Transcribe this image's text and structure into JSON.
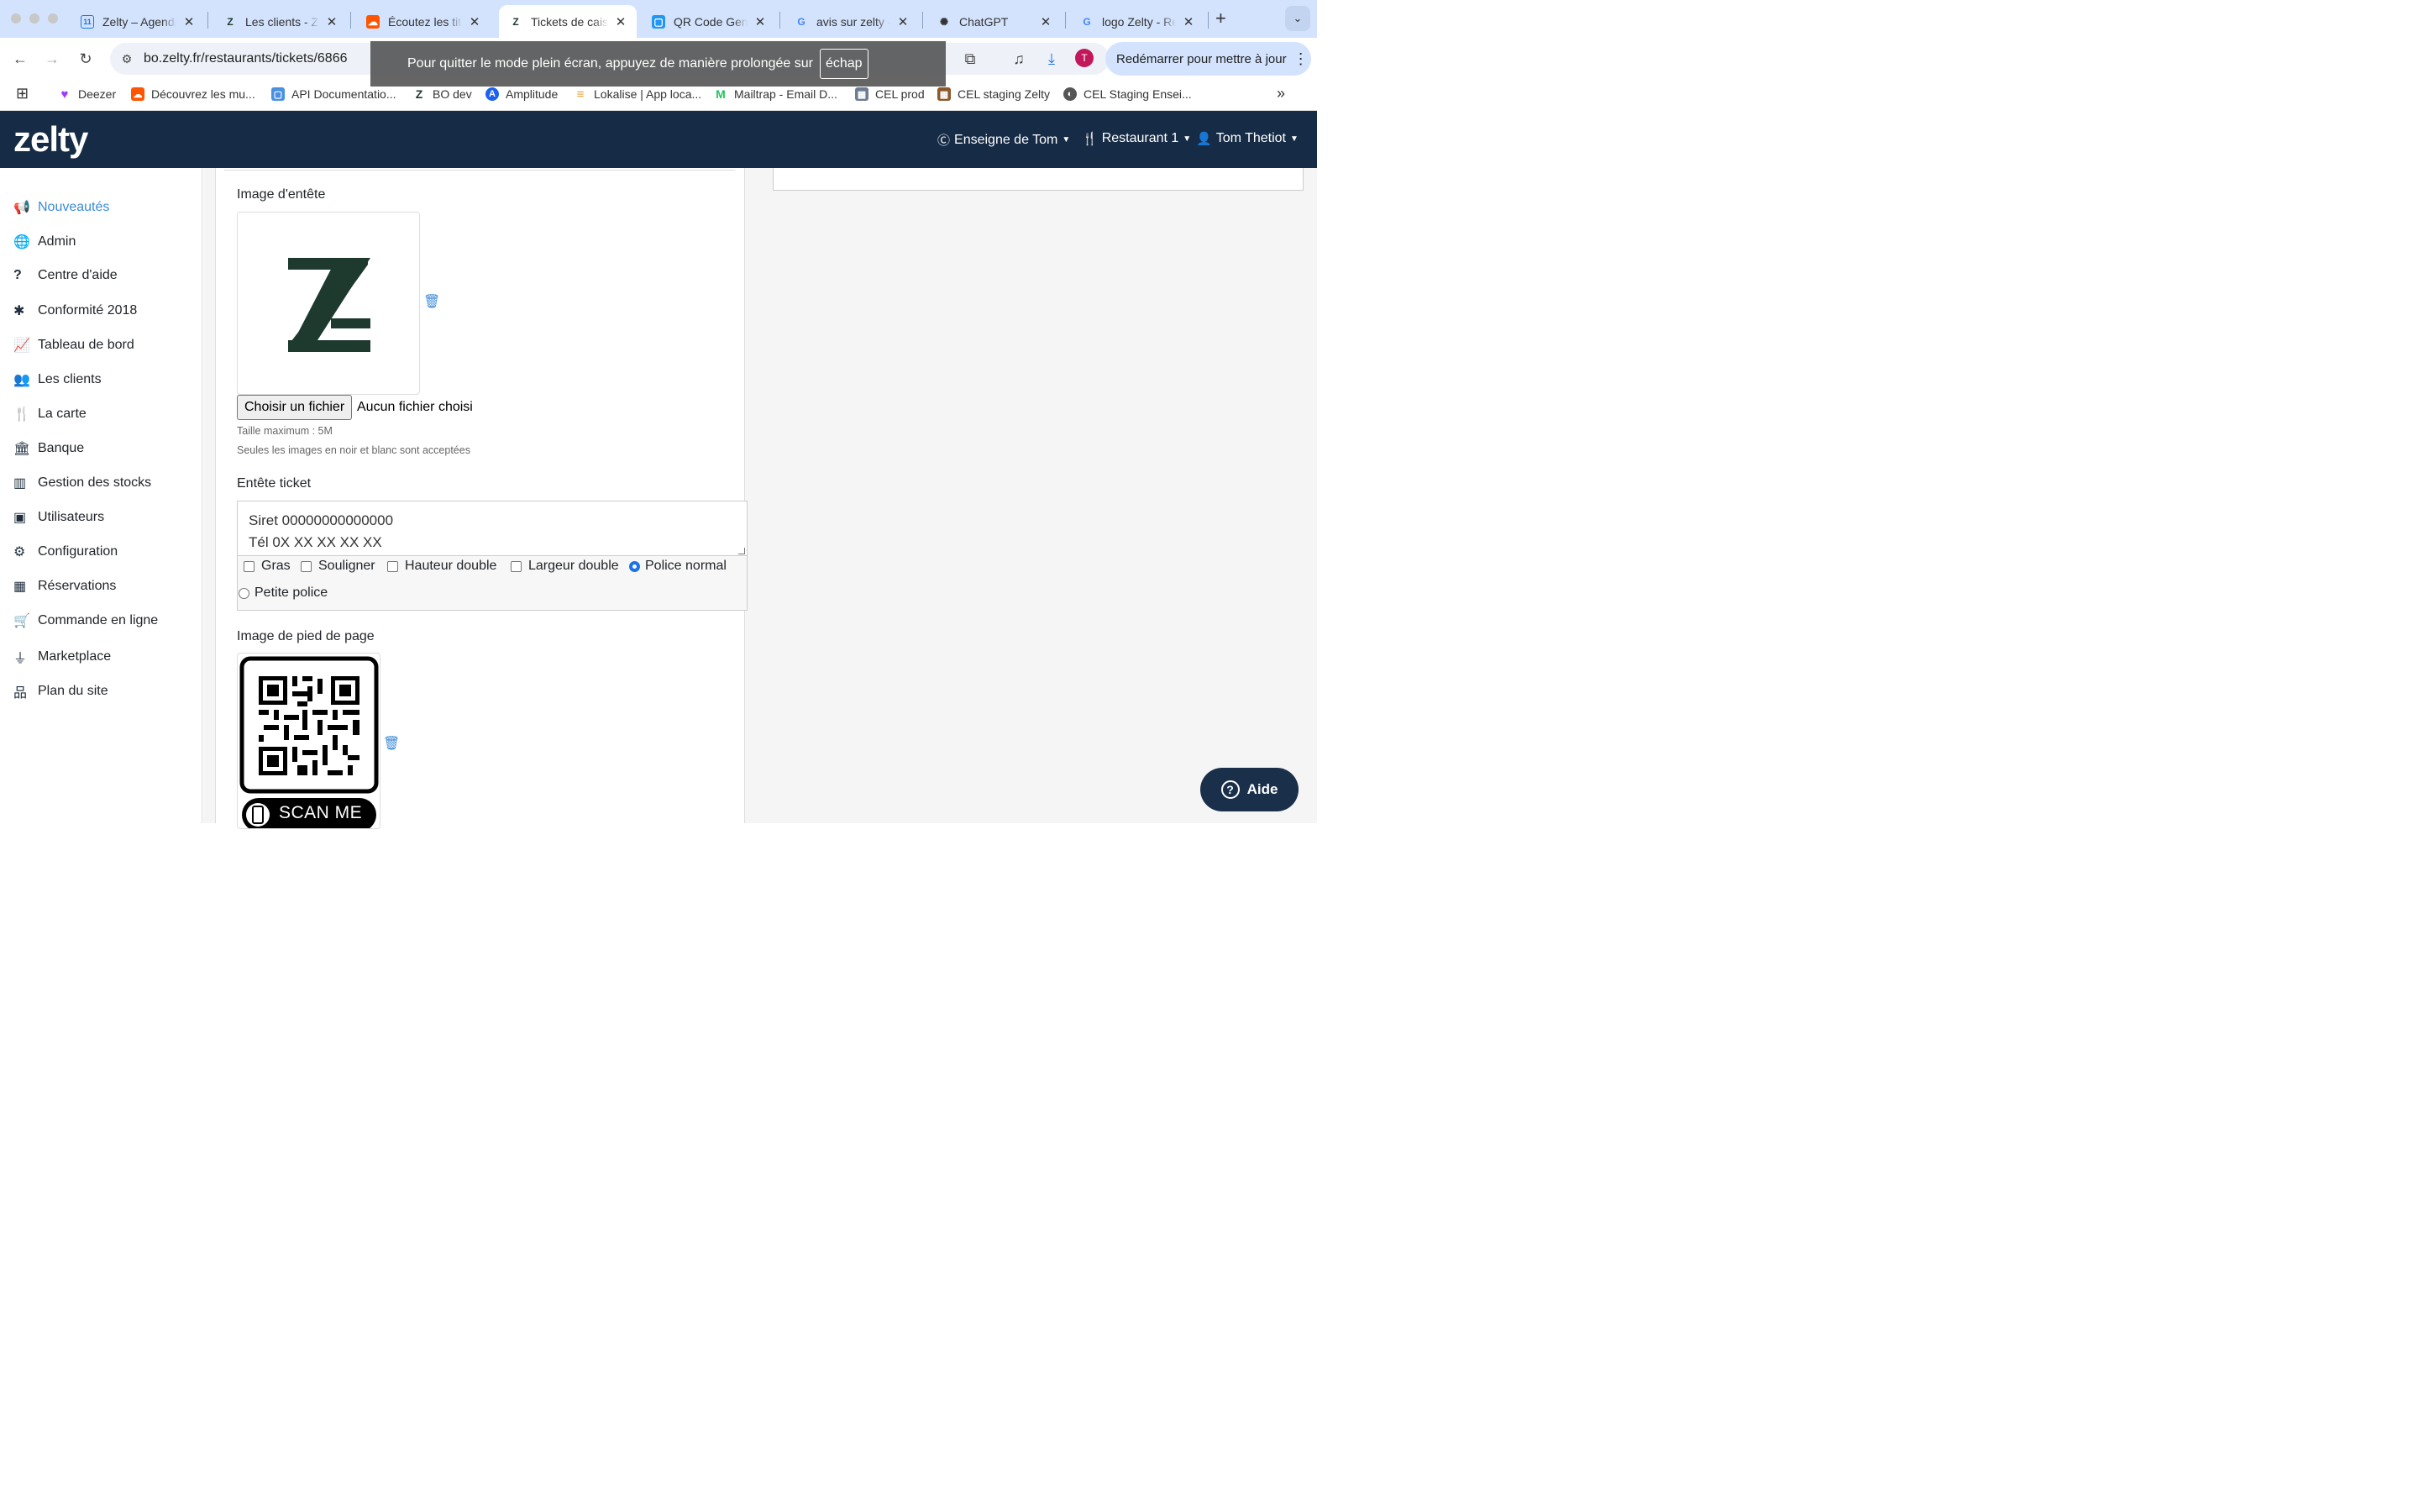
{
  "browser": {
    "tabs": [
      {
        "title": "Zelty – Agenda",
        "fav": "11",
        "fav_color": "#1a73e8",
        "fav_bg": "#ffffff"
      },
      {
        "title": "Les clients - Zelty",
        "fav": "Z",
        "fav_color": "#1e3a2f",
        "fav_bg": "transparent"
      },
      {
        "title": "Écoutez les titres",
        "fav": "☁",
        "fav_color": "#ffffff",
        "fav_bg": "#ff5500"
      },
      {
        "title": "Tickets de caisse",
        "fav": "Z",
        "fav_color": "#1e3a2f",
        "fav_bg": "transparent"
      },
      {
        "title": "QR Code Generator",
        "fav": "▢",
        "fav_color": "#ffffff",
        "fav_bg": "#2196f3"
      },
      {
        "title": "avis sur zelty -",
        "fav": "G",
        "fav_color": "#4285f4",
        "fav_bg": "transparent"
      },
      {
        "title": "ChatGPT",
        "fav": "✺",
        "fav_color": "#333333",
        "fav_bg": "transparent"
      },
      {
        "title": "logo Zelty - Recherche",
        "fav": "G",
        "fav_color": "#4285f4",
        "fav_bg": "transparent"
      }
    ],
    "new_tab": "+",
    "url": "bo.zelty.fr/restaurants/tickets/6866",
    "fullscreen_notice": "Pour quitter le mode plein écran, appuyez de manière prolongée sur",
    "fullscreen_key": "échap",
    "avatar_letter": "T",
    "restart_label": "Redémarrer pour mettre à jour",
    "bookmarks": [
      {
        "label": "Deezer",
        "icon": "♥",
        "color": "#a238ff"
      },
      {
        "label": "Découvrez les mu...",
        "icon": "☁",
        "color": "#ff5500"
      },
      {
        "label": "API Documentatio...",
        "icon": "▢",
        "color": "#4a90e2"
      },
      {
        "label": "BO dev",
        "icon": "Z",
        "color": "#1e3a2f"
      },
      {
        "label": "Amplitude",
        "icon": "A",
        "color": "#1e61f0"
      },
      {
        "label": "Lokalise | App loca...",
        "icon": "≡",
        "color": "#e8a33d"
      },
      {
        "label": "Mailtrap - Email D...",
        "icon": "M",
        "color": "#22c55e"
      },
      {
        "label": "CEL prod",
        "icon": "▦",
        "color": "#6b7c93"
      },
      {
        "label": "CEL staging Zelty",
        "icon": "▦",
        "color": "#8b5a2b"
      },
      {
        "label": "CEL Staging Ensei...",
        "icon": "◐",
        "color": "#555555"
      }
    ],
    "bookmarks_more": "»"
  },
  "app": {
    "logo": "zelty",
    "brand_menu": "Enseigne de Tom",
    "restaurant_menu": "Restaurant 1",
    "user_menu": "Tom Thetiot"
  },
  "sidebar": {
    "items": [
      {
        "label": "Nouveautés",
        "icon": "megaphone-icon",
        "glyph": "📢"
      },
      {
        "label": "Admin",
        "icon": "globe-icon",
        "glyph": "🌐"
      },
      {
        "label": "Centre d'aide",
        "icon": "question-icon",
        "glyph": "?"
      },
      {
        "label": "Conformité 2018",
        "icon": "asterisk-icon",
        "glyph": "✱"
      },
      {
        "label": "Tableau de bord",
        "icon": "chart-line-icon",
        "glyph": "📈"
      },
      {
        "label": "Les clients",
        "icon": "users-icon",
        "glyph": "👥"
      },
      {
        "label": "La carte",
        "icon": "utensils-icon",
        "glyph": "🍴"
      },
      {
        "label": "Banque",
        "icon": "bank-icon",
        "glyph": "🏛"
      },
      {
        "label": "Gestion des stocks",
        "icon": "barcode-icon",
        "glyph": "▥"
      },
      {
        "label": "Utilisateurs",
        "icon": "id-badge-icon",
        "glyph": "▣"
      },
      {
        "label": "Configuration",
        "icon": "gear-icon",
        "glyph": "⚙"
      },
      {
        "label": "Réservations",
        "icon": "calendar-icon",
        "glyph": "▦"
      },
      {
        "label": "Commande en ligne",
        "icon": "cart-icon",
        "glyph": "🛒"
      },
      {
        "label": "Marketplace",
        "icon": "plug-icon",
        "glyph": "⏚"
      },
      {
        "label": "Plan du site",
        "icon": "sitemap-icon",
        "glyph": "品"
      }
    ]
  },
  "form": {
    "header_image_label": "Image d'entête",
    "choose_file_label": "Choisir un fichier",
    "no_file_label": "Aucun fichier choisi",
    "max_size": "Taille maximum : 5M",
    "bw_only": "Seules les images en noir et blanc sont acceptées",
    "ticket_header_label": "Entête ticket",
    "ticket_header_value": "Siret 00000000000000\nTél 0X XX XX XX XX",
    "options": {
      "bold": "Gras",
      "underline": "Souligner",
      "double_height": "Hauteur double",
      "double_width": "Largeur double",
      "normal_font": "Police normal",
      "small_font": "Petite police"
    },
    "selected_font": "normal",
    "footer_image_label": "Image de pied de page",
    "qr_caption": "SCAN ME"
  },
  "help_button": "Aide",
  "colors": {
    "appbar": "#162b45",
    "accent": "#3b8bd9",
    "logo_green": "#1e3a2f"
  }
}
